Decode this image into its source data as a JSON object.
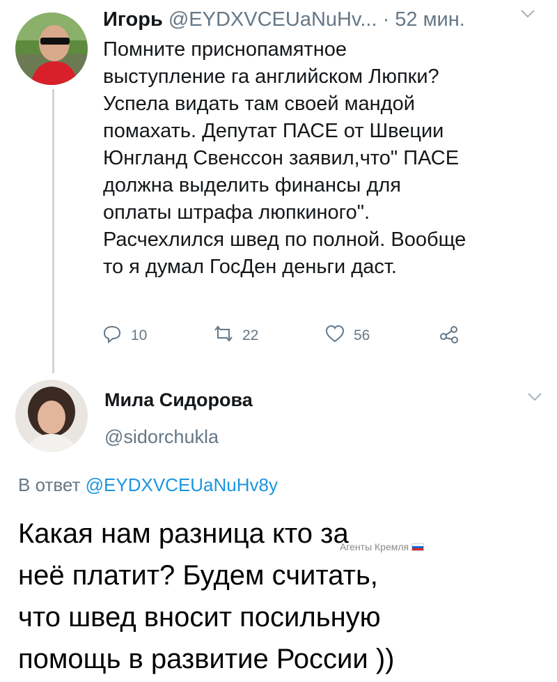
{
  "tweet1": {
    "author_name": "Игорь",
    "author_handle": "@EYDXVCEUaNuHv...",
    "time": "· 52 мин.",
    "lines": [
      "Помните приснопамятное",
      "выступление га английском Люпки?",
      "Успела видать там своей мандой",
      "помахать. Депутат ПАСЕ от Швеции",
      "Юнгланд Свенссон заявил,что\" ПАСЕ",
      "должна выделить финансы для",
      "оплаты штрафа люпкиного\".",
      "Расчехлился швед по полной. Вообще",
      "то я думал ГосДен деньги даст."
    ],
    "actions": {
      "reply_count": "10",
      "retweet_count": "22",
      "like_count": "56"
    }
  },
  "tweet2": {
    "author_name": "Мила Сидорова",
    "author_handle": "@sidorchukla",
    "reply_prefix": "В ответ",
    "reply_mention": "@EYDXVCEUaNuHv8y",
    "lines": [
      "Какая нам разница кто за",
      "неё платит? Будем считать,",
      "что швед вносит посильную",
      "помощь в развитие России ))"
    ]
  },
  "watermark": "Агенты Кремля",
  "icons": {
    "reply": "reply-icon",
    "retweet": "retweet-icon",
    "like": "heart-icon",
    "share": "share-icon",
    "menu": "chevron-down-icon"
  },
  "colors": {
    "secondary_text": "#657786",
    "link": "#1b95e0",
    "thread_line": "#cdd5db"
  }
}
